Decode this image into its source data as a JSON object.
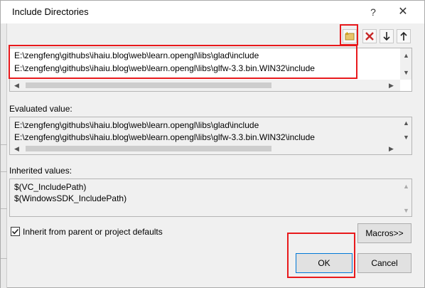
{
  "window": {
    "title": "Include Directories",
    "help_label": "?",
    "close_label": "✕"
  },
  "toolbar": {
    "icons": [
      "new-line-icon",
      "delete-icon",
      "move-down-icon",
      "move-up-icon"
    ]
  },
  "include_list": {
    "lines": [
      "E:\\zengfeng\\githubs\\ihaiu.blog\\web\\learn.opengl\\libs\\glad\\include",
      "E:\\zengfeng\\githubs\\ihaiu.blog\\web\\learn.opengl\\libs\\glfw-3.3.bin.WIN32\\include"
    ]
  },
  "evaluated": {
    "label": "Evaluated value:",
    "lines": [
      "E:\\zengfeng\\githubs\\ihaiu.blog\\web\\learn.opengl\\libs\\glad\\include",
      "E:\\zengfeng\\githubs\\ihaiu.blog\\web\\learn.opengl\\libs\\glfw-3.3.bin.WIN32\\include"
    ]
  },
  "inherited": {
    "label": "Inherited values:",
    "lines": [
      "$(VC_IncludePath)",
      "$(WindowsSDK_IncludePath)"
    ]
  },
  "options": {
    "inherit_label": "Inherit from parent or project defaults",
    "inherit_checked": true
  },
  "buttons": {
    "macros": "Macros>>",
    "ok": "OK",
    "cancel": "Cancel"
  },
  "colors": {
    "highlight": "#e8191c",
    "accent": "#0078d7"
  }
}
